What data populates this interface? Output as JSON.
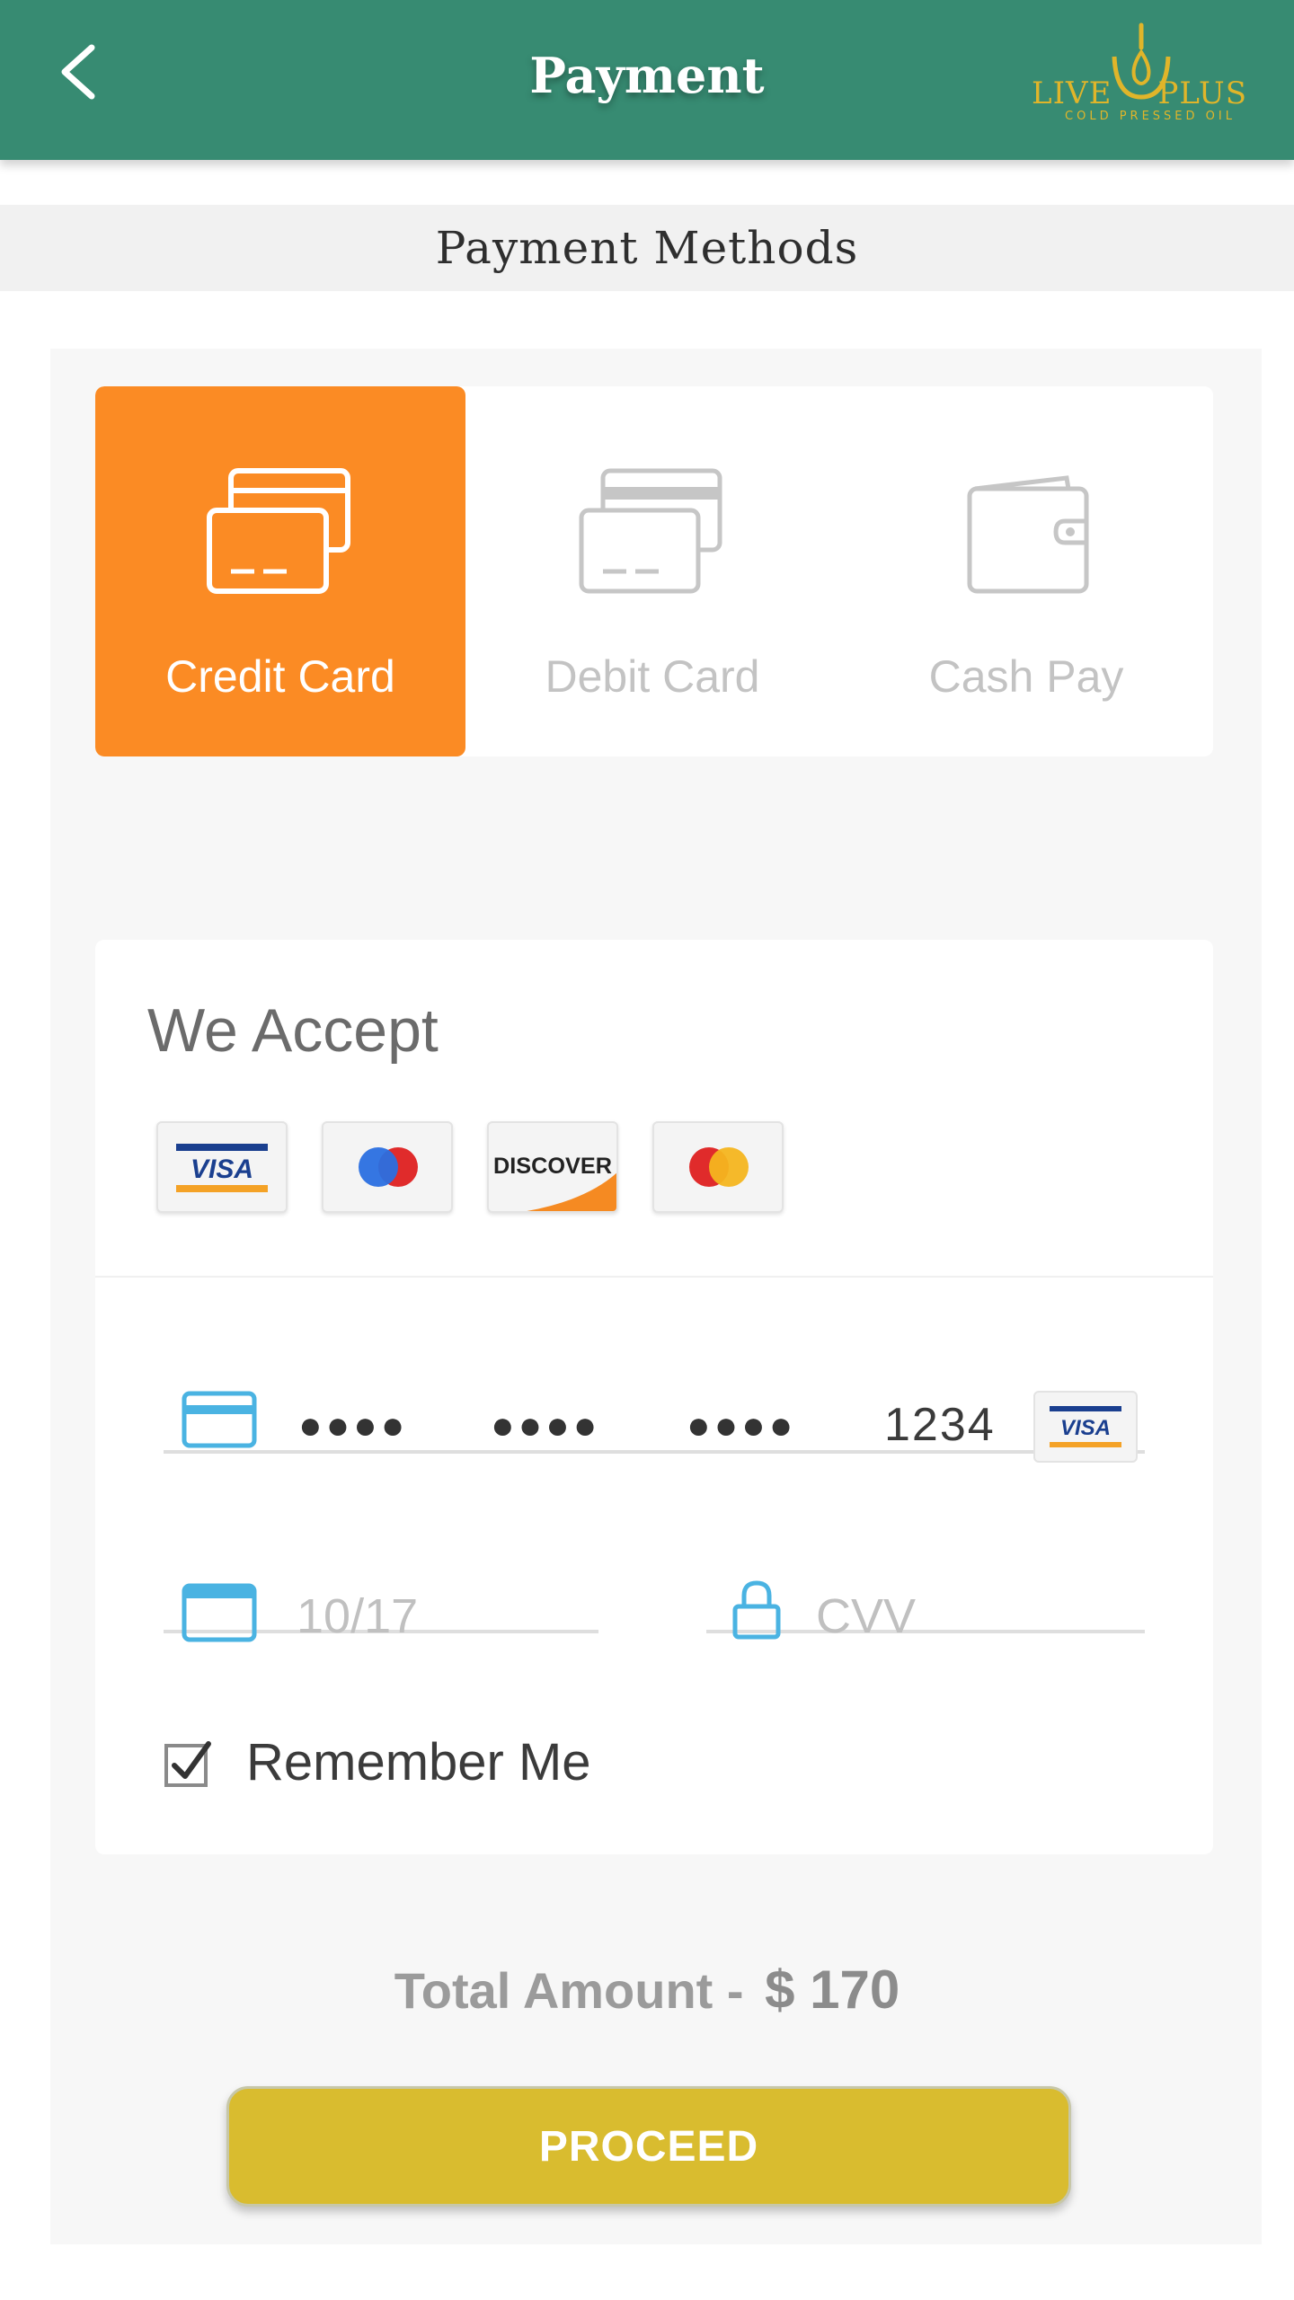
{
  "header": {
    "title": "Payment",
    "brand_left": "LIVE",
    "brand_right": "PLUS",
    "brand_sub": "COLD PRESSED OIL"
  },
  "section": {
    "title": "Payment Methods"
  },
  "methods": [
    {
      "label": "Credit Card",
      "icon": "credit-card-icon",
      "selected": true
    },
    {
      "label": "Debit Card",
      "icon": "debit-card-icon",
      "selected": false
    },
    {
      "label": "Cash Pay",
      "icon": "wallet-icon",
      "selected": false
    }
  ],
  "accept": {
    "title": "We Accept",
    "logos": [
      "VISA",
      "Maestro",
      "DISCOVER",
      "Mastercard"
    ]
  },
  "form": {
    "card_number_masked": [
      "●●●●",
      "●●●●",
      "●●●●"
    ],
    "card_last4": "1234",
    "card_brand": "VISA",
    "expiry": "10/17",
    "cvv_placeholder": "CVV",
    "remember_label": "Remember Me",
    "remember_checked": true
  },
  "total": {
    "label": "Total Amount -",
    "value": "$ 170"
  },
  "actions": {
    "proceed": "PROCEED"
  },
  "colors": {
    "header": "#378b72",
    "selected_tab": "#fb8b24",
    "proceed": "#d9bc2f",
    "field_icon": "#4ab3e2"
  }
}
